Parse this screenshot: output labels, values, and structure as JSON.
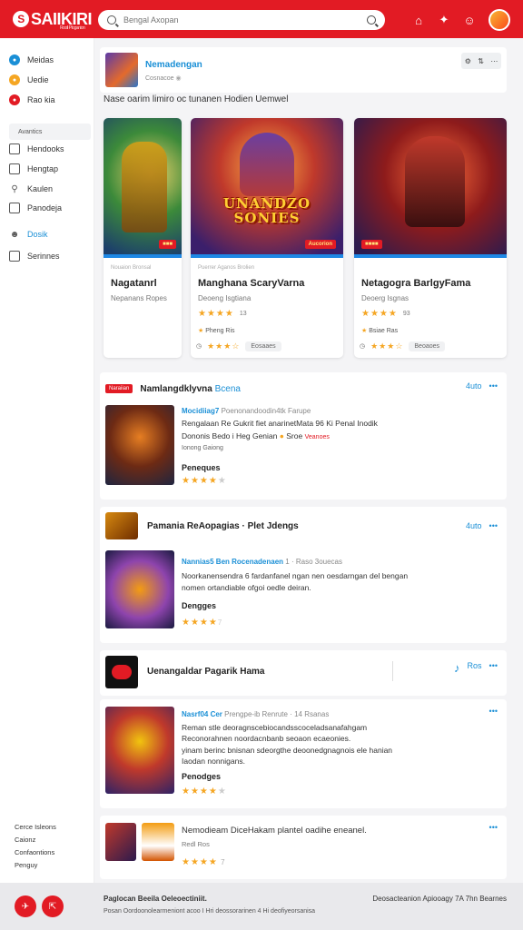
{
  "header": {
    "logo": "SAIIKIRI",
    "logo_sub": "Rooli Ploganion",
    "search_placeholder": "Bengal Axopan"
  },
  "sidebar": {
    "items": [
      {
        "label": "Meidas",
        "color": "#1a8fd6"
      },
      {
        "label": "Uedie",
        "color": "#f5a623"
      },
      {
        "label": "Rao kia",
        "color": "#e21b24"
      }
    ],
    "section": "Avantics",
    "items2": [
      {
        "label": "Hendooks"
      },
      {
        "label": "Hengtap"
      },
      {
        "label": "Kaulen"
      },
      {
        "label": "Panodeja"
      },
      {
        "label": "Dosik",
        "active": true
      },
      {
        "label": "Serinnes"
      }
    ],
    "footer": [
      "Cerce Isleons",
      "Caionz",
      "Confaontions",
      "Penguy"
    ]
  },
  "channel": {
    "title": "Nemadengan",
    "subtitle": "Cosnacoe"
  },
  "featured_heading": "Nase oarim limiro oc tunanen Hodien Uemwel",
  "featured": [
    {
      "meta": "Nouaion Bronsal",
      "name": "Nagatanrl",
      "sub": "Nepanans Ropes",
      "tag": "",
      "foot": "",
      "art": "",
      "badge": "",
      "stars": 0
    },
    {
      "meta": "Puerrer Aganos Brolien",
      "name": "Manghana ScaryVarna",
      "sub": "Deoeng Isgtiana",
      "rating": "13",
      "tag": "Pheng Ris",
      "foot": "Eosaaes",
      "art": "UNANDZO SONIES",
      "badge": "Aucorion",
      "stars": 4
    },
    {
      "meta": "",
      "name": "Netagogra BarlgyFama",
      "sub": "Deoerg Isgnas",
      "rating": "93",
      "tag": "Bsiae Ras",
      "foot": "Beoaoes",
      "art": "",
      "badge": "",
      "stars": 4
    }
  ],
  "rows": [
    {
      "tag": "Naraiian",
      "title": "Namlangdklyvna",
      "title_link": "Bcena",
      "more": "4uto",
      "line1_blue": "Mocidiiag7",
      "line1_gray": "Poenonandoodin4tk Farupe",
      "line2": "Rengalaan Re Gukrit fiet anarinetMata 96 Ki Penal Inodik",
      "line3": "Dononis Bedo i Heg Genian",
      "line3_tag": "Sroe",
      "line3_red": "Veanoes",
      "line4": "Ionong Gaiong",
      "label": "Peneques",
      "stars": 4
    },
    {
      "title": "Pamania ReAopagias · Plet Jdengs",
      "more": "4uto",
      "line1_blue": "Nannias5 Ben Rocenadenaen",
      "line1_gray": "1 · Raso 3ouecas",
      "line2": "Noorkanensendra 6 fardanfanel ngan nen oesdarngan del bengan",
      "line3": "nomen ortandiable ofgoi oedle deiran.",
      "label": "Dengges",
      "stars": 4
    },
    {
      "title": "Uenangaldar Pagarik Hama",
      "more": "Ros"
    },
    {
      "line1_blue": "Nasrf04 Cer",
      "line1_gray": "Prengpe-ib Renrute · 14 Rsanas",
      "line2": "Reman stle deoragnscebiocandsscoceladsanafahgam",
      "line3": "Reconorahnen noordacnbanb seoaon ecaeonies.",
      "line4": "yinam berinc bnisnan sdeorgthe deoonedgnagnois ele hanian",
      "line5": "Iaodan nonnigans.",
      "label": "Penodges",
      "stars": 4
    },
    {
      "line1": "Nemodieam DiceHakam plantel oadihe eneanel.",
      "line2": "Redl Ros",
      "stars": 4
    }
  ],
  "footer": {
    "left_title": "Paglocan Beeila Oeleoectiniit.",
    "left_line": "Posan Oordoonolearmeniont acoo I Hri deossorarinen 4 Hi deofiyeorsanisa",
    "right": "Deosacteanion Apiooagy 7A 7hn Bearnes"
  },
  "colors": {
    "accent": "#e21b24",
    "link": "#1a8fd6",
    "star": "#f5a623"
  }
}
